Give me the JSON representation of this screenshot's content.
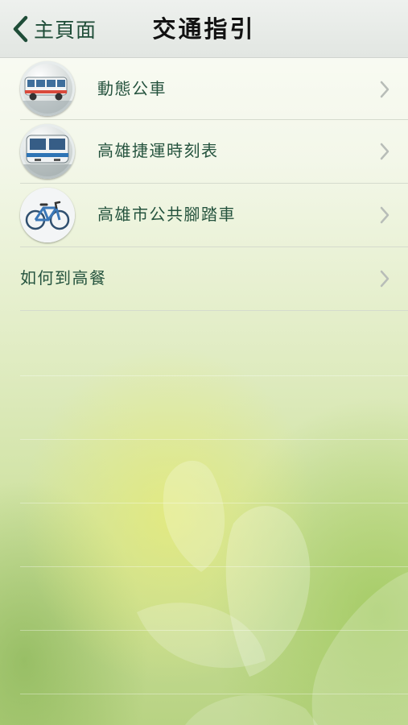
{
  "navbar": {
    "back_label": "主頁面",
    "title": "交通指引"
  },
  "list": {
    "items": [
      {
        "label": "動態公車",
        "icon": "bus-icon"
      },
      {
        "label": "高雄捷運時刻表",
        "icon": "metro-train-icon"
      },
      {
        "label": "高雄市公共腳踏車",
        "icon": "bicycle-icon"
      },
      {
        "label": "如何到高餐"
      }
    ]
  },
  "colors": {
    "label_text": "#25533e",
    "accent_green": "#1f4d38",
    "chevron": "#b8bdb8",
    "separator": "#d5dbcd"
  }
}
